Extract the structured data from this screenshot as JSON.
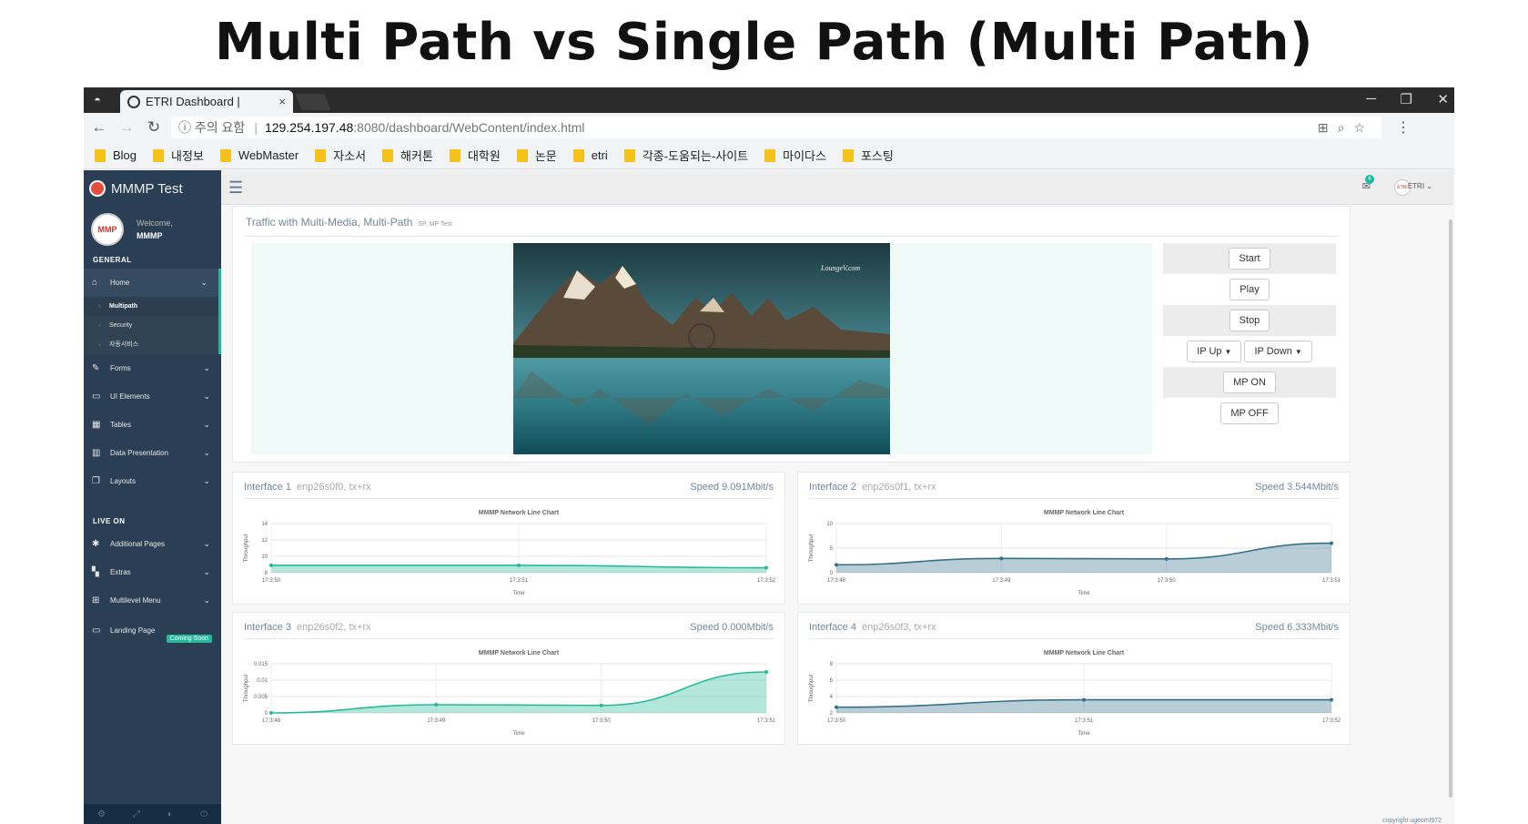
{
  "slide_title": "Multi Path vs Single Path (Multi Path)",
  "browser": {
    "tab_title": "ETRI Dashboard |",
    "tab_close": "×",
    "window_controls": [
      "─",
      "❐",
      "✕"
    ],
    "security_label": "ⓘ 주의 요함",
    "url_host": "129.254.197.48",
    "url_path": ":8080/dashboard/WebContent/index.html",
    "bookmarks": [
      "Blog",
      "내정보",
      "WebMaster",
      "자소서",
      "해커톤",
      "대학원",
      "논문",
      "etri",
      "각종-도움되는-사이트",
      "마이다스",
      "포스팅"
    ]
  },
  "sidebar": {
    "brand": "MMMP Test",
    "welcome": "Welcome,",
    "user": "MMMP",
    "general_header": "GENERAL",
    "home": {
      "label": "Home",
      "children": [
        "Multipath",
        "Security",
        "자동서비스"
      ]
    },
    "general_items": [
      {
        "label": "Forms",
        "icon": "edit-icon"
      },
      {
        "label": "UI Elements",
        "icon": "desktop-icon"
      },
      {
        "label": "Tables",
        "icon": "table-icon"
      },
      {
        "label": "Data Presentation",
        "icon": "bar-chart-icon"
      },
      {
        "label": "Layouts",
        "icon": "clone-icon"
      }
    ],
    "live_header": "LIVE ON",
    "live_items": [
      {
        "label": "Additional Pages",
        "icon": "bug-icon"
      },
      {
        "label": "Extras",
        "icon": "windows-icon"
      },
      {
        "label": "Multilevel Menu",
        "icon": "sitemap-icon"
      }
    ],
    "landing": "Landing Page",
    "coming_soon": "Coming Soon"
  },
  "topnav": {
    "notification_count": "6",
    "username": "ETRI"
  },
  "main": {
    "panel_title": "Traffic with Multi-Media, Multi-Path",
    "panel_subtitle": "SP, MP Test",
    "watermark": "LoungeV.com",
    "buttons": {
      "start": "Start",
      "play": "Play",
      "stop": "Stop",
      "ip_up": "IP Up",
      "ip_down": "IP Down",
      "mp_on": "MP ON",
      "mp_off": "MP OFF"
    },
    "copyright": "copyright ugeoml972"
  },
  "interfaces": [
    {
      "title": "Interface 1",
      "sub": "enp26s0f0, tx+rx",
      "speed": "Speed  9.091Mbit/s"
    },
    {
      "title": "Interface 2",
      "sub": "enp26s0f1, tx+rx",
      "speed": "Speed  3.544Mbit/s"
    },
    {
      "title": "Interface 3",
      "sub": "enp26s0f2, tx+rx",
      "speed": "Speed  0.000Mbit/s"
    },
    {
      "title": "Interface 4",
      "sub": "enp26s0f3, tx+rx",
      "speed": "Speed  6.333Mbit/s"
    }
  ],
  "chart_data": [
    {
      "type": "area",
      "title": "MMMP Network Line Chart",
      "xlabel": "Time",
      "ylabel": "Throughput",
      "x": [
        "17:3:50",
        "17:3:51",
        "17:3:52"
      ],
      "x_ticks": [
        "17:3:50",
        "17:3:51",
        "17:3:52"
      ],
      "series": [
        {
          "values": [
            8.9,
            8.9,
            8.6
          ]
        }
      ],
      "y_ticks": [
        8,
        10,
        12,
        14
      ],
      "ylim": [
        8,
        14
      ],
      "color": "#26b99a",
      "grid": true
    },
    {
      "type": "area",
      "title": "MMMP Network Line Chart",
      "xlabel": "Time",
      "ylabel": "Throughput",
      "x": [
        "17:3:48",
        "17:3:49",
        "17:3:50",
        "17:3:51"
      ],
      "x_ticks": [
        "17:3:48",
        "17:3:49",
        "17:3:50",
        "17:3:51"
      ],
      "series": [
        {
          "values": [
            1.6,
            2.9,
            2.8,
            6.0
          ]
        }
      ],
      "y_ticks": [
        0,
        5,
        10
      ],
      "ylim": [
        0,
        10
      ],
      "color": "#34718a",
      "grid": true
    },
    {
      "type": "area",
      "title": "MMMP Network Line Chart",
      "xlabel": "Time",
      "ylabel": "Throughput",
      "x": [
        "17:3:48",
        "17:3:49",
        "17:3:50",
        "17:3:51"
      ],
      "x_ticks": [
        "17:3:48",
        "17:3:49",
        "17:3:50",
        "17:3:51"
      ],
      "series": [
        {
          "values": [
            0.0,
            0.0025,
            0.0023,
            0.0125
          ]
        }
      ],
      "y_ticks": [
        0,
        0.005,
        0.01,
        0.015
      ],
      "ylim": [
        0,
        0.015
      ],
      "color": "#26b99a",
      "grid": true
    },
    {
      "type": "area",
      "title": "MMMP Network Line Chart",
      "xlabel": "Time",
      "ylabel": "Throughput",
      "x": [
        "17:3:50",
        "17:3:51",
        "17:3:52"
      ],
      "x_ticks": [
        "17:3:50",
        "17:3:51",
        "17:3:52"
      ],
      "series": [
        {
          "values": [
            2.7,
            3.6,
            3.6
          ]
        }
      ],
      "y_ticks": [
        2,
        4,
        6,
        8
      ],
      "ylim": [
        2,
        8
      ],
      "color": "#34718a",
      "grid": true
    }
  ]
}
